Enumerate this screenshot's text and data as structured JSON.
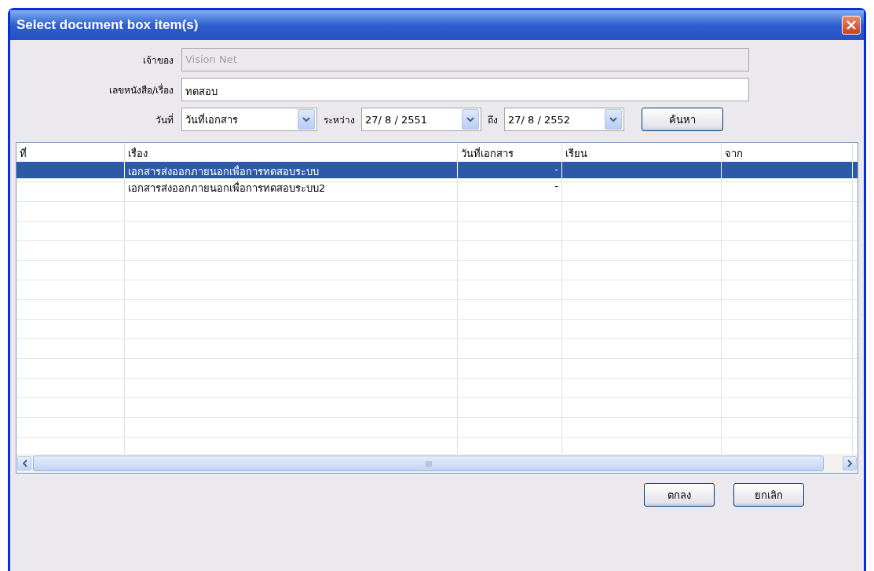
{
  "window": {
    "title": "Select document box item(s)"
  },
  "form": {
    "owner": {
      "label": "เจ้าของ",
      "value": "Vision Net",
      "disabled": true
    },
    "subject": {
      "label": "เลขหนังสือ/เรื่อง",
      "value": "ทดสอบ"
    },
    "date_type": {
      "label": "วันที่",
      "value": "วันที่เอกสาร"
    },
    "between_label": "ระหว่าง",
    "from_date": "27/ 8 /  2551",
    "to_label": "ถึง",
    "to_date": "27/ 8 /  2552",
    "search_button": "ค้นหา"
  },
  "table": {
    "columns": [
      "ที่",
      "เรื่อง",
      "วันที่เอกสาร",
      "เรียน",
      "จาก"
    ],
    "rows": [
      {
        "selected": true,
        "cells": [
          "",
          "เอกสารส่งออกภายนอกเพื่อการทดสอบระบบ",
          "-",
          "",
          ""
        ]
      },
      {
        "selected": false,
        "cells": [
          "",
          "เอกสารส่งออกภายนอกเพื่อการทดสอบระบบ2",
          "-",
          "",
          ""
        ]
      }
    ]
  },
  "buttons": [
    "ตกลง",
    "ยกเลิก"
  ]
}
